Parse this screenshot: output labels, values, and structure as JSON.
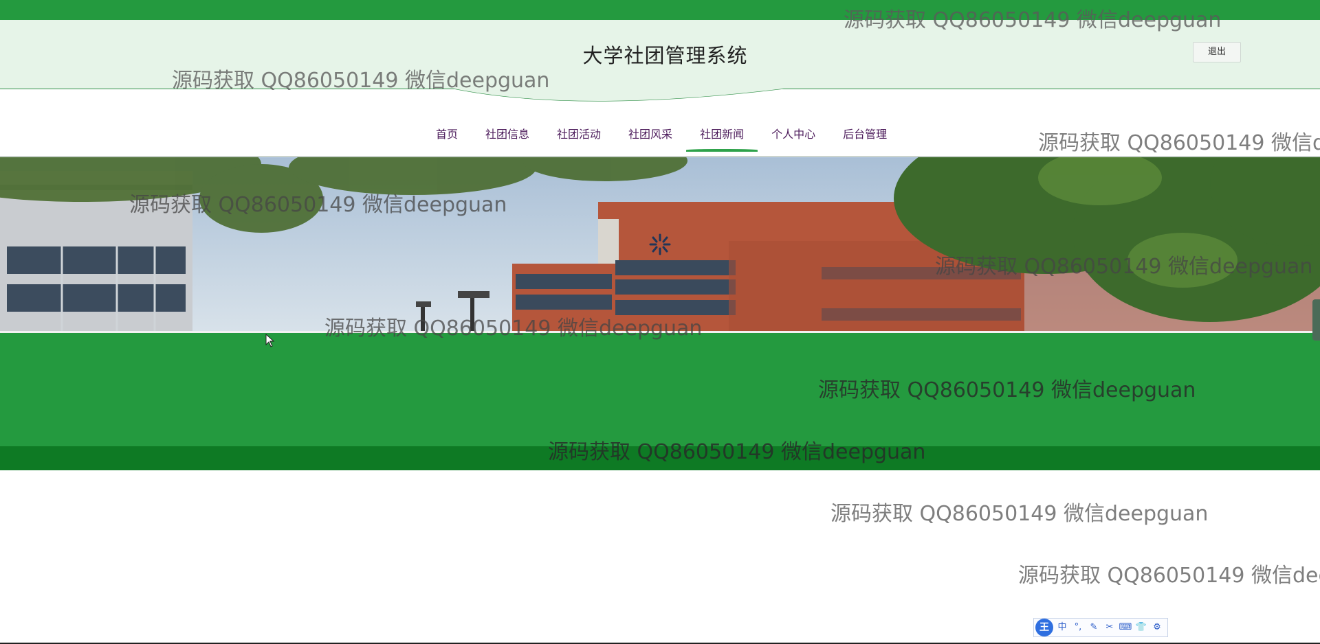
{
  "header": {
    "title": "大学社团管理系统",
    "logout_label": "退出"
  },
  "nav": {
    "items": [
      {
        "label": "首页"
      },
      {
        "label": "社团信息"
      },
      {
        "label": "社团活动"
      },
      {
        "label": "社团风采"
      },
      {
        "label": "社团新闻"
      },
      {
        "label": "个人中心"
      },
      {
        "label": "后台管理"
      }
    ],
    "active_index": 4
  },
  "watermark": {
    "text": "源码获取 QQ86050149 微信deepguan"
  },
  "ime_toolbar": {
    "logo": "王",
    "mode": "中",
    "icons": [
      "punctuation-icon",
      "pen-icon",
      "scissors-icon",
      "keyboard-icon",
      "skin-icon",
      "settings-icon"
    ]
  },
  "colors": {
    "primary_green": "#249a3f",
    "dark_green": "#0e7a24",
    "header_bg": "#e6f4e8",
    "nav_text": "#4b1a5a"
  }
}
